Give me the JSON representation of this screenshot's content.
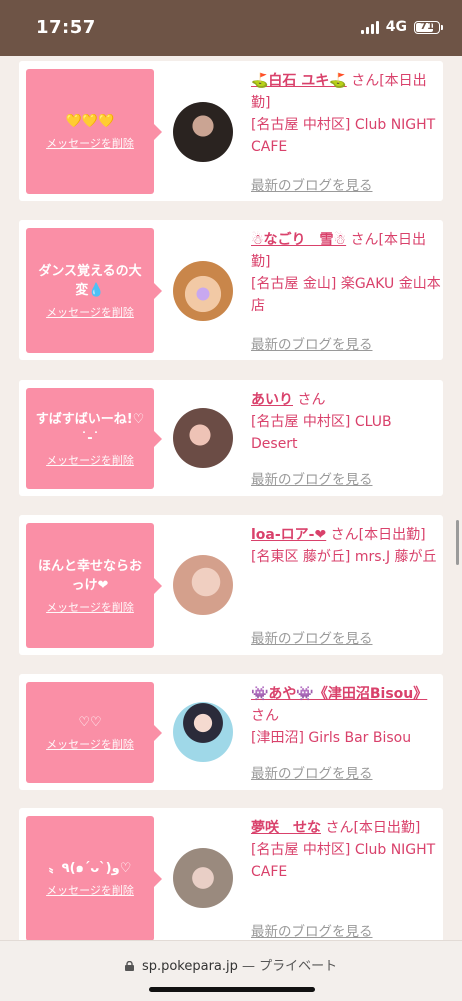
{
  "status_bar": {
    "time": "17:57",
    "network": "4G",
    "battery": "71"
  },
  "delete_label": "メッセージを削除",
  "blog_label": "最新のブログを見る",
  "cards": [
    {
      "message": "💛💛💛",
      "name": "⛳白石 ユキ⛳",
      "suffix": "さん[本日出勤]",
      "shop": "[名古屋 中村区] Club NIGHT CAFE"
    },
    {
      "message": "ダンス覚えるの大変💧",
      "name": "☃なごり　雪☃",
      "suffix": "さん[本日出勤]",
      "shop": "[名古屋 金山] 楽GAKU 金山本店"
    },
    {
      "message": "すばすばいーね!♡ ˙-˙",
      "name": "あいり",
      "suffix": "さん",
      "shop": "[名古屋 中村区] CLUB Desert"
    },
    {
      "message": "ほんと幸せならおっけ❤",
      "name": "loa-ロア-❤",
      "suffix": "さん[本日出勤]",
      "shop": "[名東区 藤が丘] mrs.J 藤が丘"
    },
    {
      "message": "♡♡",
      "name": "👾あや👾《津田沼Bisou》",
      "suffix": "さん",
      "shop": "[津田沼] Girls Bar Bisou"
    },
    {
      "message": "〟٩(๑´ᴗ`)و♡",
      "name": "夢咲　せな",
      "suffix": "さん[本日出勤]",
      "shop": "[名古屋 中村区] Club NIGHT CAFE"
    }
  ],
  "url_bar": {
    "domain": "sp.pokepara.jp",
    "separator": "—",
    "mode": "プライベート"
  }
}
